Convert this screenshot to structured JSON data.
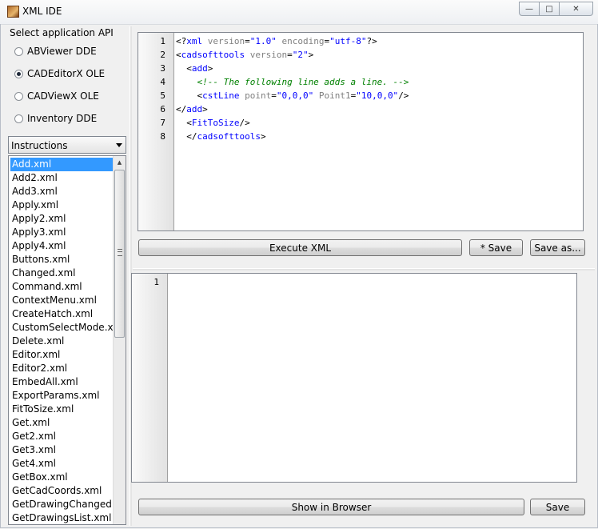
{
  "window": {
    "title": "XML IDE",
    "minimize": "—",
    "maximize": "□",
    "close": "✕"
  },
  "api": {
    "title": "Select application API",
    "options": [
      {
        "label": "ABViewer DDE",
        "selected": false
      },
      {
        "label": "CADEditorX OLE",
        "selected": true
      },
      {
        "label": "CADViewX OLE",
        "selected": false
      },
      {
        "label": "Inventory DDE",
        "selected": false
      }
    ]
  },
  "category": {
    "selected": "Instructions"
  },
  "files": {
    "selected": "Add.xml",
    "items": [
      "Add.xml",
      "Add2.xml",
      "Add3.xml",
      "Apply.xml",
      "Apply2.xml",
      "Apply3.xml",
      "Apply4.xml",
      "Buttons.xml",
      "Changed.xml",
      "Command.xml",
      "ContextMenu.xml",
      "CreateHatch.xml",
      "CustomSelectMode.xml",
      "Delete.xml",
      "Editor.xml",
      "Editor2.xml",
      "EmbedAll.xml",
      "ExportParams.xml",
      "FitToSize.xml",
      "Get.xml",
      "Get2.xml",
      "Get3.xml",
      "Get4.xml",
      "GetBox.xml",
      "GetCadCoords.xml",
      "GetDrawingChanged.xml",
      "GetDrawingsList.xml"
    ]
  },
  "editor": {
    "line_numbers": [
      "1",
      "2",
      "3",
      "4",
      "5",
      "6",
      "7",
      "8"
    ],
    "lines": [
      [
        {
          "c": "t-br",
          "t": "<?"
        },
        {
          "c": "t-tag",
          "t": "xml"
        },
        {
          "c": "t-att",
          "t": " version"
        },
        {
          "c": "t-br",
          "t": "="
        },
        {
          "c": "t-val",
          "t": "\"1.0\""
        },
        {
          "c": "t-att",
          "t": " encoding"
        },
        {
          "c": "t-br",
          "t": "="
        },
        {
          "c": "t-val",
          "t": "\"utf-8\""
        },
        {
          "c": "t-br",
          "t": "?>"
        }
      ],
      [
        {
          "c": "t-br",
          "t": "<"
        },
        {
          "c": "t-tag",
          "t": "cadsofttools"
        },
        {
          "c": "t-att",
          "t": " version"
        },
        {
          "c": "t-br",
          "t": "="
        },
        {
          "c": "t-val",
          "t": "\"2\""
        },
        {
          "c": "t-br",
          "t": ">"
        }
      ],
      [
        {
          "c": "t-br",
          "t": "  <"
        },
        {
          "c": "t-tag",
          "t": "add"
        },
        {
          "c": "t-br",
          "t": ">"
        }
      ],
      [
        {
          "c": "t-com",
          "t": "    <!-- The following line adds a line. -->"
        }
      ],
      [
        {
          "c": "t-br",
          "t": "    <"
        },
        {
          "c": "t-tag",
          "t": "cstLine"
        },
        {
          "c": "t-att",
          "t": " point"
        },
        {
          "c": "t-br",
          "t": "="
        },
        {
          "c": "t-val",
          "t": "\"0,0,0\""
        },
        {
          "c": "t-att",
          "t": " Point1"
        },
        {
          "c": "t-br",
          "t": "="
        },
        {
          "c": "t-val",
          "t": "\"10,0,0\""
        },
        {
          "c": "t-br",
          "t": "/>"
        }
      ],
      [
        {
          "c": "t-br",
          "t": "</"
        },
        {
          "c": "t-tag",
          "t": "add"
        },
        {
          "c": "t-br",
          "t": ">"
        }
      ],
      [
        {
          "c": "t-br",
          "t": "  <"
        },
        {
          "c": "t-tag",
          "t": "FitToSize"
        },
        {
          "c": "t-br",
          "t": "/>"
        }
      ],
      [
        {
          "c": "t-br",
          "t": "  </"
        },
        {
          "c": "t-tag",
          "t": "cadsofttools"
        },
        {
          "c": "t-br",
          "t": ">"
        }
      ]
    ]
  },
  "toolbar": {
    "execute": "Execute XML",
    "save": "* Save",
    "save_as": "Save as..."
  },
  "output": {
    "line_numbers": [
      "1"
    ]
  },
  "bottom": {
    "show_browser": "Show in Browser",
    "save": "Save"
  }
}
